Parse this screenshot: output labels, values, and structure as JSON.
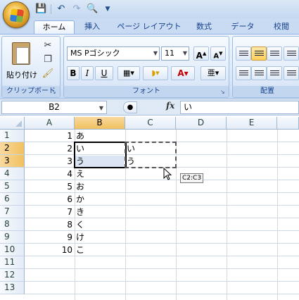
{
  "qat": {
    "save_icon": "save-icon",
    "undo_icon": "undo-icon",
    "redo_icon": "redo-icon",
    "preview_icon": "print-preview-icon",
    "customize_icon": "chevron-down-icon"
  },
  "tabs": [
    {
      "label": "ホーム",
      "active": true
    },
    {
      "label": "挿入"
    },
    {
      "label": "ページ レイアウト"
    },
    {
      "label": "数式"
    },
    {
      "label": "データ"
    },
    {
      "label": "校閲"
    }
  ],
  "clipboard": {
    "paste_label": "貼り付け",
    "group_label": "クリップボード"
  },
  "font": {
    "name": "MS Pゴシック",
    "size": "11",
    "bold": "B",
    "italic": "I",
    "underline": "U",
    "grow": "A",
    "shrink": "A",
    "group_label": "フォント",
    "font_color": "A",
    "phonetic": "亜"
  },
  "alignment": {
    "group_label": "配置"
  },
  "formula_bar": {
    "name_box": "B2",
    "fx": "fx",
    "content": "い"
  },
  "columns": [
    "A",
    "B",
    "C",
    "D",
    "E"
  ],
  "rows": [
    "1",
    "2",
    "3",
    "4",
    "5",
    "6",
    "7",
    "8",
    "9",
    "10",
    "11",
    "12",
    "13"
  ],
  "cells": {
    "A": [
      "1",
      "2",
      "3",
      "4",
      "5",
      "6",
      "7",
      "8",
      "9",
      "10"
    ],
    "B": [
      "あ",
      "い",
      "う",
      "え",
      "お",
      "か",
      "き",
      "く",
      "け",
      "こ"
    ],
    "C": [
      "",
      "い",
      "う"
    ]
  },
  "drag_tooltip": "C2:C3",
  "colors": {
    "selection_fill": "#dbe5f4",
    "header_selected": "#f1c15f",
    "ribbon": "#d9e7f8"
  }
}
